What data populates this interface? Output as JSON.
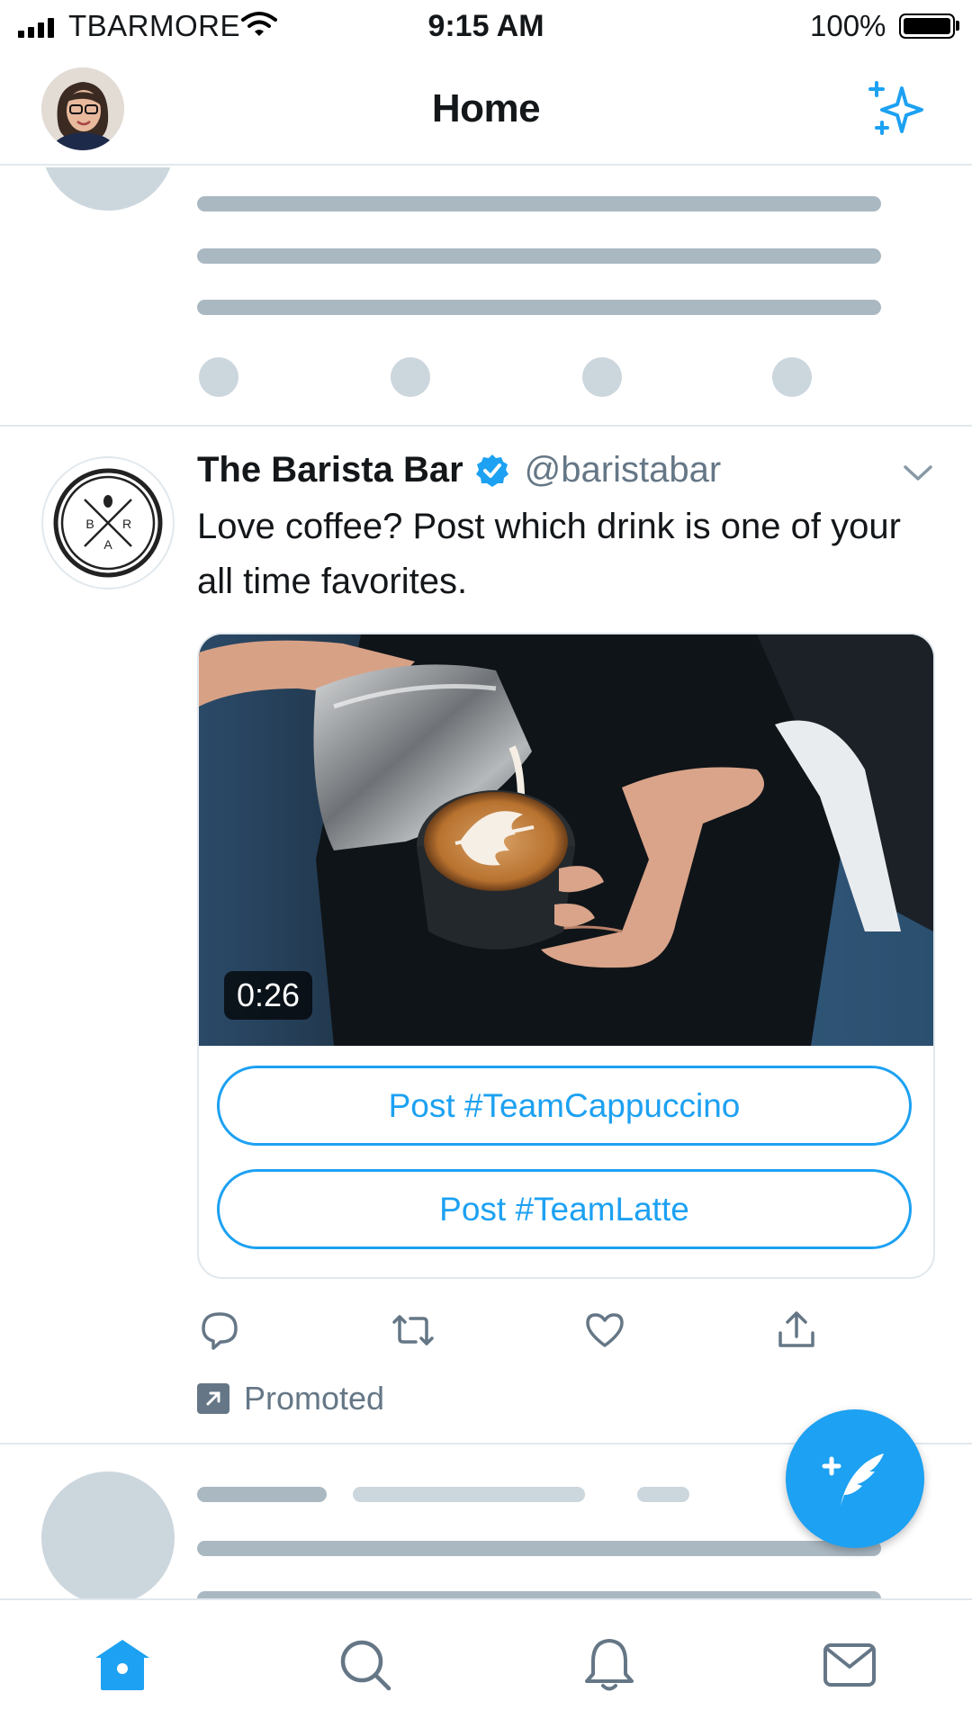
{
  "status_bar": {
    "carrier": "TBARMORE",
    "time": "9:15 AM",
    "battery": "100%"
  },
  "header": {
    "title": "Home",
    "avatar_icon": "user-avatar-photo",
    "sparkle_icon": "sparkle-icon"
  },
  "tweet": {
    "display_name": "The Barista Bar",
    "handle": "@baristabar",
    "verified": true,
    "text": "Love coffee? Post which drink is one of your all time favorites.",
    "logo_letters": [
      "B",
      "R",
      "A"
    ],
    "video_duration": "0:26",
    "buttons": [
      "Post #TeamCappuccino",
      "Post #TeamLatte"
    ],
    "actions": [
      "reply-icon",
      "retweet-icon",
      "like-icon",
      "share-icon"
    ],
    "promoted_label": "Promoted"
  },
  "tabbar": {
    "tabs": [
      "home-icon",
      "search-icon",
      "notifications-icon",
      "messages-icon"
    ],
    "active": "home-icon"
  },
  "colors": {
    "accent": "#1da1f2",
    "text_primary": "#14171a",
    "text_secondary": "#657786",
    "skeleton_dark": "#aab8c2",
    "skeleton_light": "#ccd6dd",
    "divider": "#e1e8ed"
  }
}
